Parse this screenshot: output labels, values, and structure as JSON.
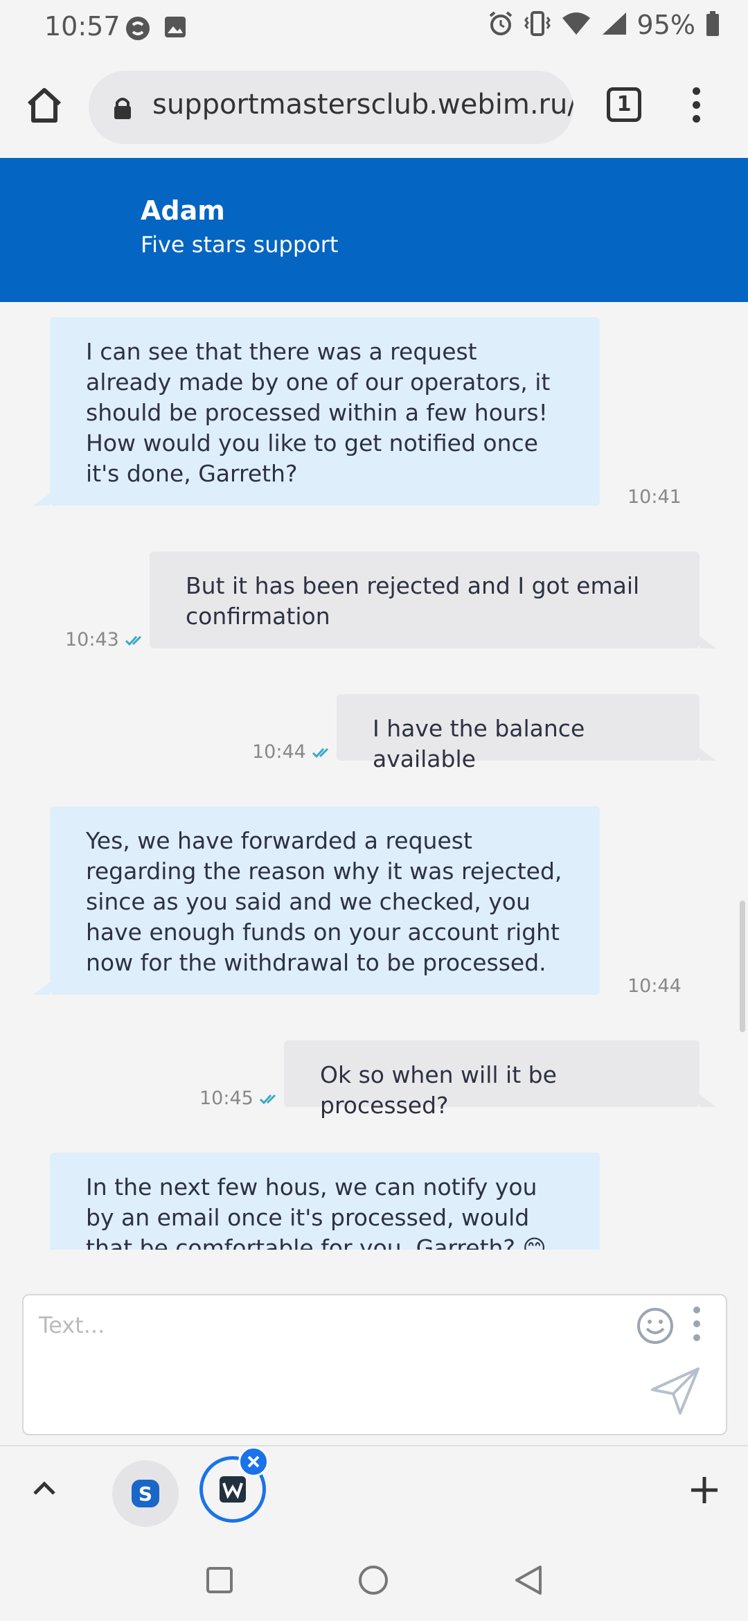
{
  "status_bar": {
    "time": "10:57",
    "battery": "95%"
  },
  "browser": {
    "url": "supportmastersclub.webim.ru/",
    "tab_count": "1"
  },
  "chat_header": {
    "agent_name": "Adam",
    "agent_subtitle": "Five stars support"
  },
  "messages": [
    {
      "from": "agent",
      "text": "I can see that there was a request already made by one of our operators, it should be processed within a few hours! How would you like to get notified once it's done, Garreth?",
      "time": "10:41"
    },
    {
      "from": "user",
      "text": "But it has been rejected and I got email confirmation",
      "time": "10:43"
    },
    {
      "from": "user",
      "text": "I have the balance available",
      "time": "10:44"
    },
    {
      "from": "agent",
      "text": "Yes, we have forwarded a request regarding the reason why it was rejected, since as you said and we checked, you have enough funds on your account right now for the withdrawal to be processed.",
      "time": "10:44"
    },
    {
      "from": "user",
      "text": "Ok so when will it be processed?",
      "time": "10:45"
    },
    {
      "from": "agent",
      "text": "In the next few hous, we can notify you by an email once it's processed, would that be comfortable for you, Garreth? 😊",
      "time": ""
    }
  ],
  "composer": {
    "placeholder": "Text..."
  },
  "colors": {
    "header_bg": "#0565c2",
    "agent_bubble": "#deeefb",
    "user_bubble": "#e8e8ea",
    "read_check": "#3ba7c9",
    "active_tab_ring": "#1a73e8"
  }
}
